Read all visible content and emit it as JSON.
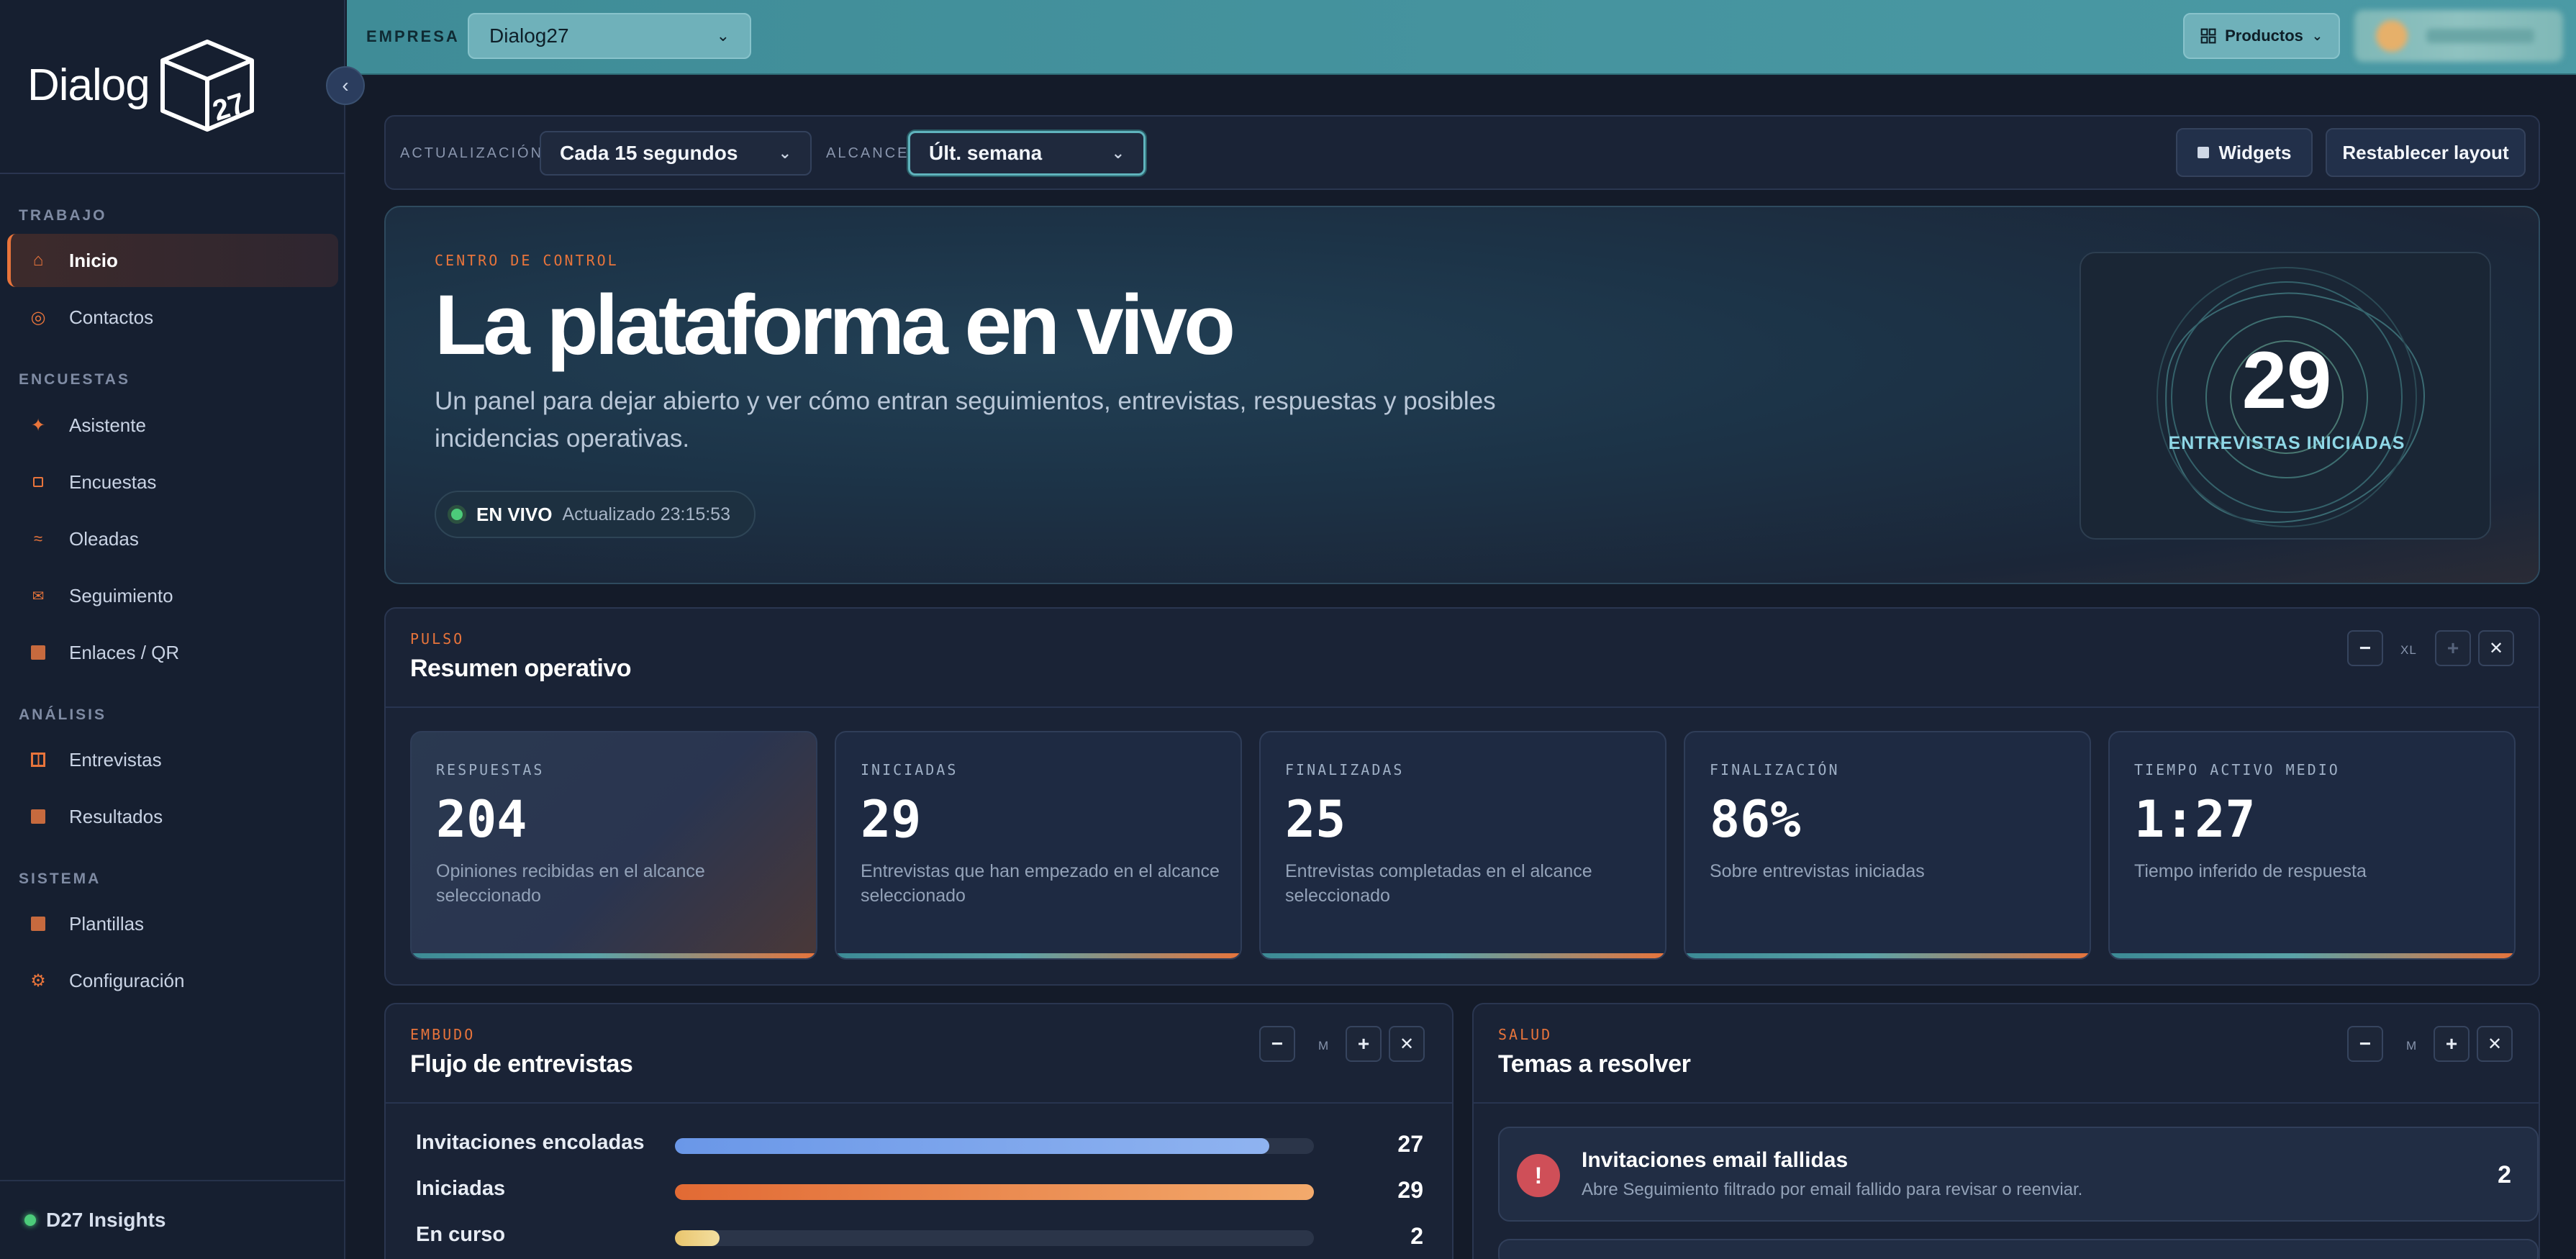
{
  "sidebar": {
    "logo_text": "Dialog",
    "logo_badge": "27",
    "sections": [
      {
        "label": "TRABAJO",
        "items": [
          {
            "label": "Inicio",
            "icon": "home-icon",
            "active": true
          },
          {
            "label": "Contactos",
            "icon": "target-icon"
          }
        ]
      },
      {
        "label": "ENCUESTAS",
        "items": [
          {
            "label": "Asistente",
            "icon": "sparkle-icon"
          },
          {
            "label": "Encuestas",
            "icon": "square-outline-icon"
          },
          {
            "label": "Oleadas",
            "icon": "waves-icon"
          },
          {
            "label": "Seguimiento",
            "icon": "mail-icon"
          },
          {
            "label": "Enlaces / QR",
            "icon": "square-icon"
          }
        ]
      },
      {
        "label": "ANÁLISIS",
        "items": [
          {
            "label": "Entrevistas",
            "icon": "columns-icon"
          },
          {
            "label": "Resultados",
            "icon": "square-icon"
          }
        ]
      },
      {
        "label": "SISTEMA",
        "items": [
          {
            "label": "Plantillas",
            "icon": "square-icon"
          },
          {
            "label": "Configuración",
            "icon": "gear-icon"
          }
        ]
      }
    ],
    "footer_label": "D27 Insights"
  },
  "topbar": {
    "empresa_label": "EMPRESA",
    "empresa_value": "Dialog27",
    "productos_label": "Productos"
  },
  "controls": {
    "actualizacion_label": "ACTUALIZACIÓN",
    "actualizacion_value": "Cada 15 segundos",
    "alcance_label": "ALCANCE",
    "alcance_value": "Últ. semana",
    "widgets_label": "Widgets",
    "reset_label": "Restablecer layout"
  },
  "hero": {
    "eyebrow": "CENTRO DE CONTROL",
    "title": "La plataforma en vivo",
    "subtitle": "Un panel para dejar abierto y ver cómo entran seguimientos, entrevistas, respuestas y posibles incidencias operativas.",
    "live_label": "EN VIVO",
    "updated": "Actualizado 23:15:53",
    "metric_value": "29",
    "metric_label": "ENTREVISTAS INICIADAS"
  },
  "resumen": {
    "eyebrow": "PULSO",
    "title": "Resumen operativo",
    "size": "XL",
    "kpis": [
      {
        "label": "RESPUESTAS",
        "value": "204",
        "desc": "Opiniones recibidas en el alcance seleccionado"
      },
      {
        "label": "INICIADAS",
        "value": "29",
        "desc": "Entrevistas que han empezado en el alcance seleccionado"
      },
      {
        "label": "FINALIZADAS",
        "value": "25",
        "desc": "Entrevistas completadas en el alcance seleccionado"
      },
      {
        "label": "FINALIZACIÓN",
        "value": "86%",
        "desc": "Sobre entrevistas iniciadas"
      },
      {
        "label": "TIEMPO ACTIVO MEDIO",
        "value": "1:27",
        "desc": "Tiempo inferido de respuesta"
      }
    ]
  },
  "embudo": {
    "eyebrow": "EMBUDO",
    "title": "Flujo de entrevistas",
    "size": "M",
    "rows": [
      {
        "label": "Invitaciones encoladas",
        "value": "27",
        "fraction": 0.93,
        "color_from": "#6a97e8",
        "color_to": "#8fb3f0"
      },
      {
        "label": "Iniciadas",
        "value": "29",
        "fraction": 1.0,
        "color_from": "#e26a34",
        "color_to": "#f3aa6c"
      },
      {
        "label": "En curso",
        "value": "2",
        "fraction": 0.07,
        "color_from": "#e9c56d",
        "color_to": "#f3dfa0"
      }
    ]
  },
  "salud": {
    "eyebrow": "SALUD",
    "title": "Temas a resolver",
    "size": "M",
    "issues": [
      {
        "title": "Invitaciones email fallidas",
        "desc": "Abre Seguimiento filtrado por email fallido para revisar o reenviar.",
        "count": "2"
      }
    ]
  },
  "colors": {
    "accent": "#e8743b",
    "teal": "#4b9aa5",
    "live": "#4ccb7a",
    "alert": "#cf4f58"
  }
}
